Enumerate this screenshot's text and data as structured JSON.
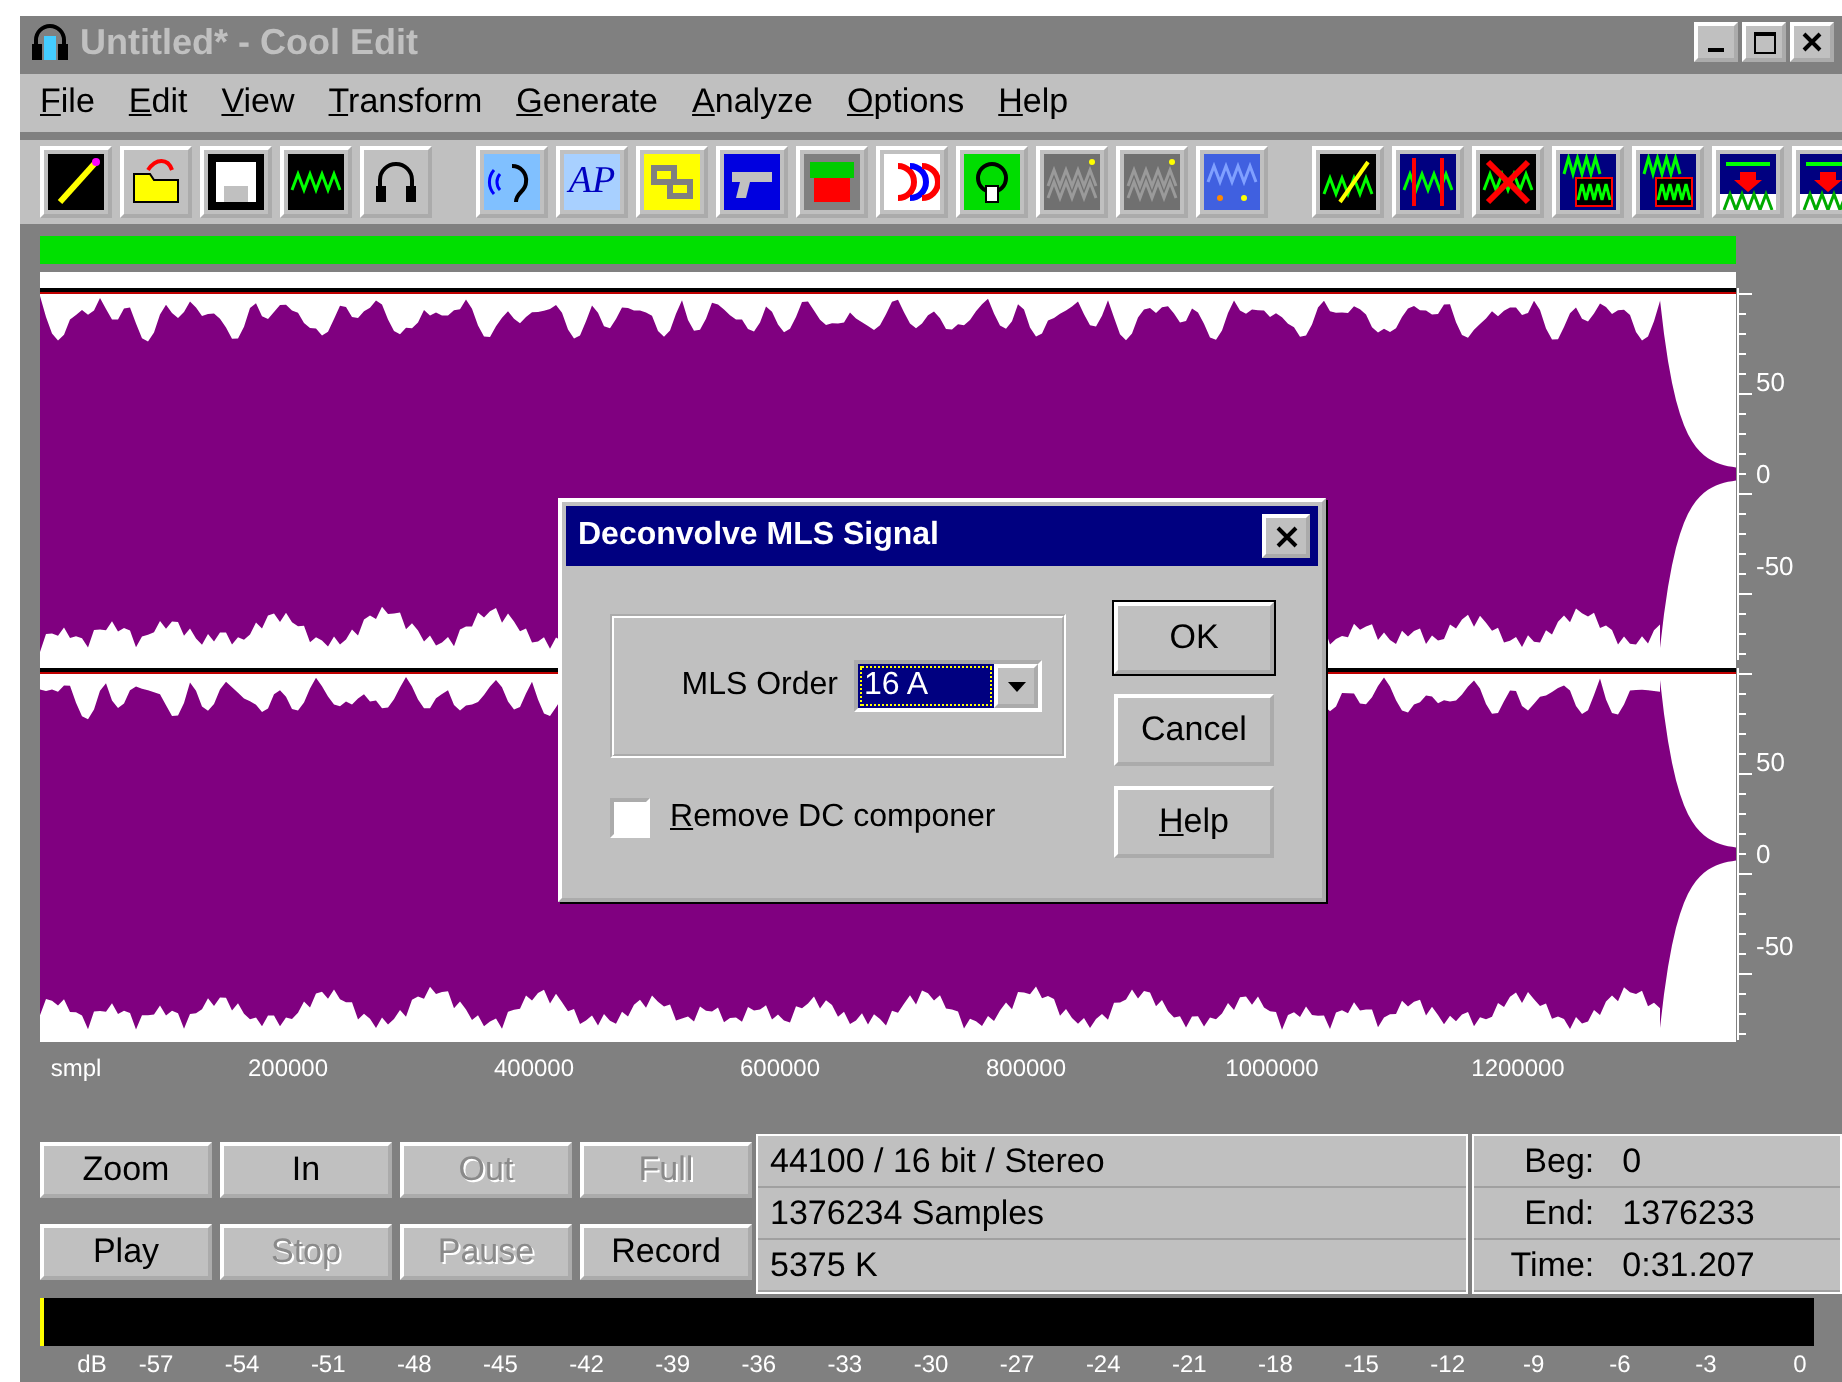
{
  "window": {
    "title": "Untitled* - Cool Edit"
  },
  "menu": [
    {
      "label": "File",
      "access_key": true
    },
    {
      "label": "Edit",
      "access_key": true
    },
    {
      "label": "View",
      "access_key": true
    },
    {
      "label": "Transform",
      "access_key": true
    },
    {
      "label": "Generate",
      "access_key": true
    },
    {
      "label": "Analyze",
      "access_key": true
    },
    {
      "label": "Options",
      "access_key": true
    },
    {
      "label": "Help",
      "access_key": true
    }
  ],
  "toolbar": [
    [
      {
        "kind": "pencil"
      },
      {
        "kind": "folder"
      },
      {
        "kind": "floppy"
      },
      {
        "kind": "floppy-wave"
      },
      {
        "kind": "headphones"
      }
    ],
    [
      {
        "kind": "ear"
      },
      {
        "kind": "text",
        "text": "AP"
      },
      {
        "kind": "link"
      },
      {
        "kind": "pistol"
      },
      {
        "kind": "chart"
      },
      {
        "kind": "arcs"
      },
      {
        "kind": "nodes"
      },
      {
        "kind": "noise"
      },
      {
        "kind": "noise"
      },
      {
        "kind": "blue-noise"
      }
    ],
    [
      {
        "kind": "wave-pencil"
      },
      {
        "kind": "wave-markers"
      },
      {
        "kind": "wave-cross"
      },
      {
        "kind": "wave-double"
      },
      {
        "kind": "wave-double"
      },
      {
        "kind": "wave-arrow"
      },
      {
        "kind": "wave-arrow"
      }
    ]
  ],
  "channels": [
    {
      "scale": [
        "50",
        "0",
        "-50"
      ]
    },
    {
      "scale": [
        "50",
        "0",
        "-50"
      ]
    }
  ],
  "time_ruler": {
    "unit": "smpl",
    "labels": [
      "200000",
      "400000",
      "600000",
      "800000",
      "1000000",
      "1200000"
    ]
  },
  "transport": [
    {
      "label": "Zoom",
      "disabled": false
    },
    {
      "label": "In",
      "disabled": false
    },
    {
      "label": "Out",
      "disabled": true
    },
    {
      "label": "Full",
      "disabled": true
    },
    {
      "label": "Play",
      "disabled": false
    },
    {
      "label": "Stop",
      "disabled": true
    },
    {
      "label": "Pause",
      "disabled": true
    },
    {
      "label": "Record",
      "disabled": false
    }
  ],
  "info": [
    "44100 / 16 bit / Stereo",
    "1376234 Samples",
    "5375 K"
  ],
  "times": [
    {
      "label": "Beg:",
      "value": "0"
    },
    {
      "label": "End:",
      "value": "1376233"
    },
    {
      "label": "Time:",
      "value": "0:31.207"
    }
  ],
  "level_meter": {
    "unit": "dB",
    "labels": [
      "-57",
      "-54",
      "-51",
      "-48",
      "-45",
      "-42",
      "-39",
      "-36",
      "-33",
      "-30",
      "-27",
      "-24",
      "-21",
      "-18",
      "-15",
      "-12",
      "-9",
      "-6",
      "-3",
      "0"
    ]
  },
  "dialog": {
    "title": "Deconvolve MLS Signal",
    "field_label": "MLS Order",
    "order": "16 A",
    "checkbox": {
      "label": "Remove DC componer",
      "checked": false,
      "access_key": true
    },
    "buttons": [
      {
        "label": "OK",
        "default": true,
        "access_key": false
      },
      {
        "label": "Cancel",
        "default": false,
        "access_key": false
      },
      {
        "label": "Help",
        "default": false,
        "access_key": true
      }
    ]
  }
}
